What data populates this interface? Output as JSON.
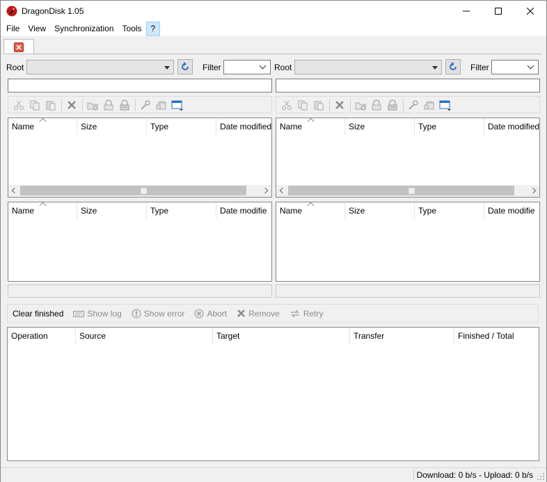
{
  "window": {
    "title": "DragonDisk 1.05",
    "icon": "dragon-icon",
    "controls": [
      "minimize-icon",
      "maximize-icon",
      "close-icon"
    ]
  },
  "menu": {
    "items": [
      "File",
      "View",
      "Synchronization",
      "Tools",
      "?"
    ],
    "highlighted": "?"
  },
  "tabs": [
    {
      "icon": "close-icon",
      "color": "#e35b45"
    }
  ],
  "panes": [
    {
      "root_label": "Root",
      "root_value": "",
      "filter_label": "Filter",
      "filter_value": "",
      "path_value": "",
      "toolbar_icons": [
        "cut-icon",
        "copy-icon",
        "paste-icon",
        "delete-icon",
        "new-folder-icon",
        "lock-icon",
        "unlock-icon",
        "properties-icon",
        "permissions-icon",
        "view-icon"
      ],
      "columns": [
        "Name",
        "Size",
        "Type",
        "Date modified"
      ],
      "lower_columns": [
        "Name",
        "Size",
        "Type",
        "Date modifie"
      ]
    },
    {
      "root_label": "Root",
      "root_value": "",
      "filter_label": "Filter",
      "filter_value": "",
      "path_value": "",
      "toolbar_icons": [
        "cut-icon",
        "copy-icon",
        "paste-icon",
        "delete-icon",
        "new-folder-icon",
        "lock-icon",
        "unlock-icon",
        "properties-icon",
        "permissions-icon",
        "view-icon"
      ],
      "columns": [
        "Name",
        "Size",
        "Type",
        "Date modified"
      ],
      "lower_columns": [
        "Name",
        "Size",
        "Type",
        "Date modifie"
      ]
    }
  ],
  "transfer_toolbar": {
    "clear_finished": "Clear finished",
    "show_log": "Show log",
    "show_error": "Show error",
    "abort": "Abort",
    "remove": "Remove",
    "retry": "Retry"
  },
  "transfer_columns": [
    "Operation",
    "Source",
    "Target",
    "Transfer",
    "Finished / Total"
  ],
  "status": {
    "text": "Download: 0 b/s - Upload: 0 b/s"
  }
}
